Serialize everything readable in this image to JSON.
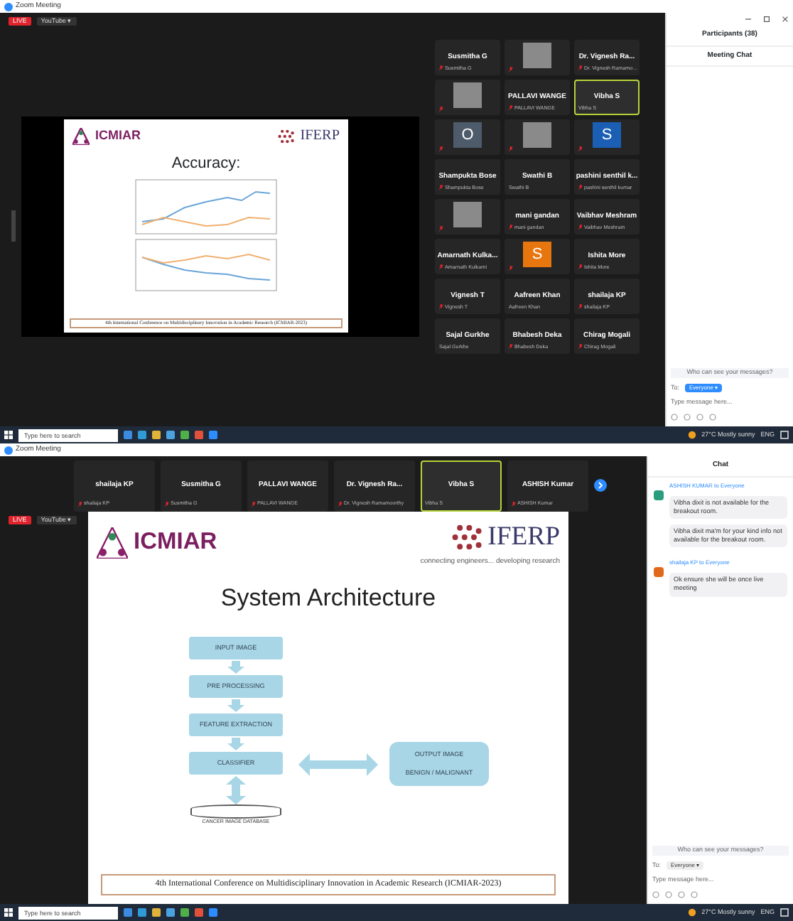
{
  "top": {
    "window_title": "Zoom Meeting",
    "live_badge": "LIVE",
    "stream_label": "YouTube ▾",
    "slide": {
      "logo_left": "ICMIAR",
      "logo_right": "IFERP",
      "title": "Accuracy:",
      "footer": "4th International Conference on Multidisciplinary Innovation in Academic Research (ICMIAR-2023)"
    },
    "gallery": [
      {
        "kind": "name",
        "name": "Susmitha G",
        "label": "Susmitha G",
        "muted": true,
        "active": false
      },
      {
        "kind": "photo",
        "muted": true,
        "active": false
      },
      {
        "kind": "name",
        "name": "Dr. Vignesh Ra...",
        "label": "Dr. Vignesh Ramamo...",
        "muted": true,
        "active": false
      },
      {
        "kind": "photo",
        "muted": true,
        "active": false
      },
      {
        "kind": "name",
        "name": "PALLAVI WANGE",
        "label": "PALLAVI WANGE",
        "muted": true,
        "active": false
      },
      {
        "kind": "name",
        "name": "Vibha S",
        "label": "Vibha S",
        "muted": false,
        "active": true
      },
      {
        "kind": "letter",
        "letter": "O",
        "color": "#4d5b6b",
        "muted": true,
        "active": false
      },
      {
        "kind": "photo",
        "muted": true,
        "active": false
      },
      {
        "kind": "letter",
        "letter": "S",
        "color": "#1a5fb4",
        "muted": true,
        "active": false
      },
      {
        "kind": "name",
        "name": "Shampukta Bose",
        "label": "Shampukta Bose",
        "muted": true,
        "active": false
      },
      {
        "kind": "name",
        "name": "Swathi B",
        "label": "Swathi B",
        "muted": false,
        "active": false
      },
      {
        "kind": "name",
        "name": "pashini senthil k...",
        "label": "pashini senthil kumar",
        "muted": true,
        "active": false
      },
      {
        "kind": "photo",
        "muted": true,
        "active": false
      },
      {
        "kind": "name",
        "name": "mani gandan",
        "label": "mani gandan",
        "muted": true,
        "active": false
      },
      {
        "kind": "name",
        "name": "Vaibhav Meshram",
        "label": "Vaibhav Meshram",
        "muted": true,
        "active": false
      },
      {
        "kind": "name",
        "name": "Amarnath Kulka...",
        "label": "Amarnath Kulkarni",
        "muted": true,
        "active": false
      },
      {
        "kind": "letter",
        "letter": "S",
        "color": "#e8760f",
        "muted": true,
        "active": false
      },
      {
        "kind": "name",
        "name": "Ishita More",
        "label": "Ishita More",
        "muted": true,
        "active": false
      },
      {
        "kind": "name",
        "name": "Vignesh T",
        "label": "Vignesh T",
        "muted": true,
        "active": false
      },
      {
        "kind": "name",
        "name": "Aafreen Khan",
        "label": "Aafreen Khan",
        "muted": false,
        "active": false
      },
      {
        "kind": "name",
        "name": "shailaja KP",
        "label": "shailaja KP",
        "muted": true,
        "active": false
      },
      {
        "kind": "name",
        "name": "Sajal Gurkhe",
        "label": "Sajal Gurkhe",
        "muted": false,
        "active": false
      },
      {
        "kind": "name",
        "name": "Bhabesh Deka",
        "label": "Bhabesh Deka",
        "muted": true,
        "active": false
      },
      {
        "kind": "name",
        "name": "Chirag Mogali",
        "label": "Chirag Mogali",
        "muted": true,
        "active": false
      }
    ],
    "panel": {
      "participants": "Participants (38)",
      "chat_title": "Meeting Chat",
      "who_can_see": "Who can see your messages?",
      "to_label": "To:",
      "recipient": "Everyone ▾",
      "placeholder": "Type message here..."
    },
    "taskbar": {
      "search": "Type here to search",
      "weather": "27°C Mostly sunny",
      "lang": "ENG"
    }
  },
  "bottom": {
    "window_title": "Zoom Meeting",
    "live_badge": "LIVE",
    "stream_label": "YouTube ▾",
    "filmstrip": [
      {
        "name": "shailaja KP",
        "label": "shailaja KP",
        "muted": true,
        "active": false
      },
      {
        "name": "Susmitha G",
        "label": "Susmitha G",
        "muted": true,
        "active": false
      },
      {
        "name": "PALLAVI WANGE",
        "label": "PALLAVI WANGE",
        "muted": true,
        "active": false
      },
      {
        "name": "Dr. Vignesh Ra...",
        "label": "Dr. Vignesh Ramamoorthy",
        "muted": true,
        "active": false
      },
      {
        "name": "Vibha S",
        "label": "Vibha S",
        "muted": false,
        "active": true
      },
      {
        "name": "ASHISH Kumar",
        "label": "ASHISH Kumar",
        "muted": true,
        "active": false
      }
    ],
    "slide": {
      "logo_left": "ICMIAR",
      "logo_right": "IFERP",
      "tagline": "connecting engineers... developing research",
      "title": "System Architecture",
      "steps": [
        "INPUT IMAGE",
        "PRE PROCESSING",
        "FEATURE EXTRACTION",
        "CLASSIFIER"
      ],
      "output": [
        "OUTPUT IMAGE",
        "BENIGN / MALIGNANT"
      ],
      "database": "CANCER IMAGE DATABASE",
      "footer": "4th International Conference on Multidisciplinary Innovation in Academic Research (ICMIAR-2023)"
    },
    "chat": {
      "title": "Chat",
      "messages": [
        {
          "sender": "ASHISH KUMAR to Everyone",
          "color": "#2a9d7f",
          "texts": [
            "Vibha dixit is not available for the breakout room.",
            "Vibha dixit ma'm for your kind info not available for the breakout room."
          ]
        },
        {
          "sender": "shailaja KP to Everyone",
          "color": "#e06a1b",
          "texts": [
            "Ok ensure she will be once live meeting"
          ]
        }
      ],
      "who_can_see": "Who can see your messages?",
      "to_label": "To:",
      "recipient": "Everyone ▾",
      "placeholder": "Type message here..."
    },
    "taskbar": {
      "search": "Type here to search",
      "weather": "27°C Mostly sunny",
      "lang": "ENG"
    }
  }
}
